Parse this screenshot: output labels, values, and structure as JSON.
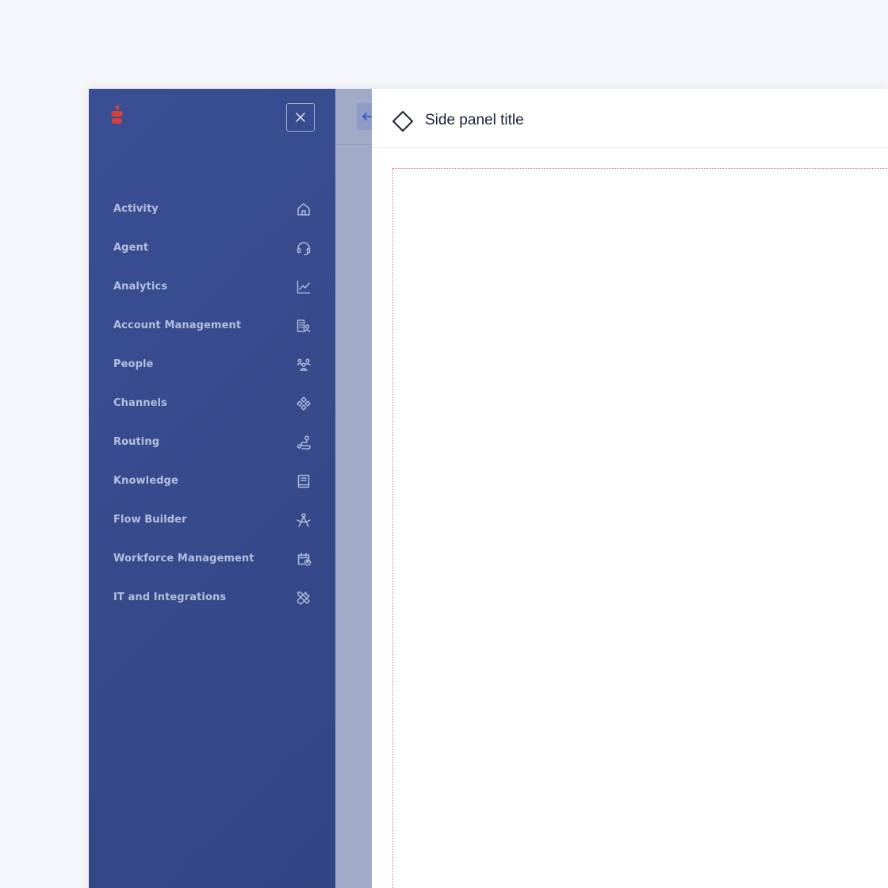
{
  "colors": {
    "sidebar_bg": "#34498a",
    "logo_red": "#d6423a",
    "backdrop": "#a1abc7",
    "accent_blue": "#3b56c4",
    "panel_body_border": "#e46c9b"
  },
  "sidebar": {
    "logo_icon": "brand-logo-icon",
    "close_icon": "close-icon",
    "items": [
      {
        "label": "Activity",
        "icon": "home-icon"
      },
      {
        "label": "Agent",
        "icon": "headset-icon"
      },
      {
        "label": "Analytics",
        "icon": "line-chart-icon"
      },
      {
        "label": "Account Management",
        "icon": "building-user-icon"
      },
      {
        "label": "People",
        "icon": "people-group-icon"
      },
      {
        "label": "Channels",
        "icon": "channels-diamond-icon"
      },
      {
        "label": "Routing",
        "icon": "route-icon"
      },
      {
        "label": "Knowledge",
        "icon": "book-icon"
      },
      {
        "label": "Flow Builder",
        "icon": "flow-builder-icon"
      },
      {
        "label": "Workforce Management",
        "icon": "calendar-user-icon"
      },
      {
        "label": "IT and Integrations",
        "icon": "tools-icon"
      }
    ]
  },
  "backdrop": {
    "back_icon": "arrow-left-icon"
  },
  "side_panel": {
    "title": "Side panel title",
    "title_icon": "diamond-icon"
  }
}
